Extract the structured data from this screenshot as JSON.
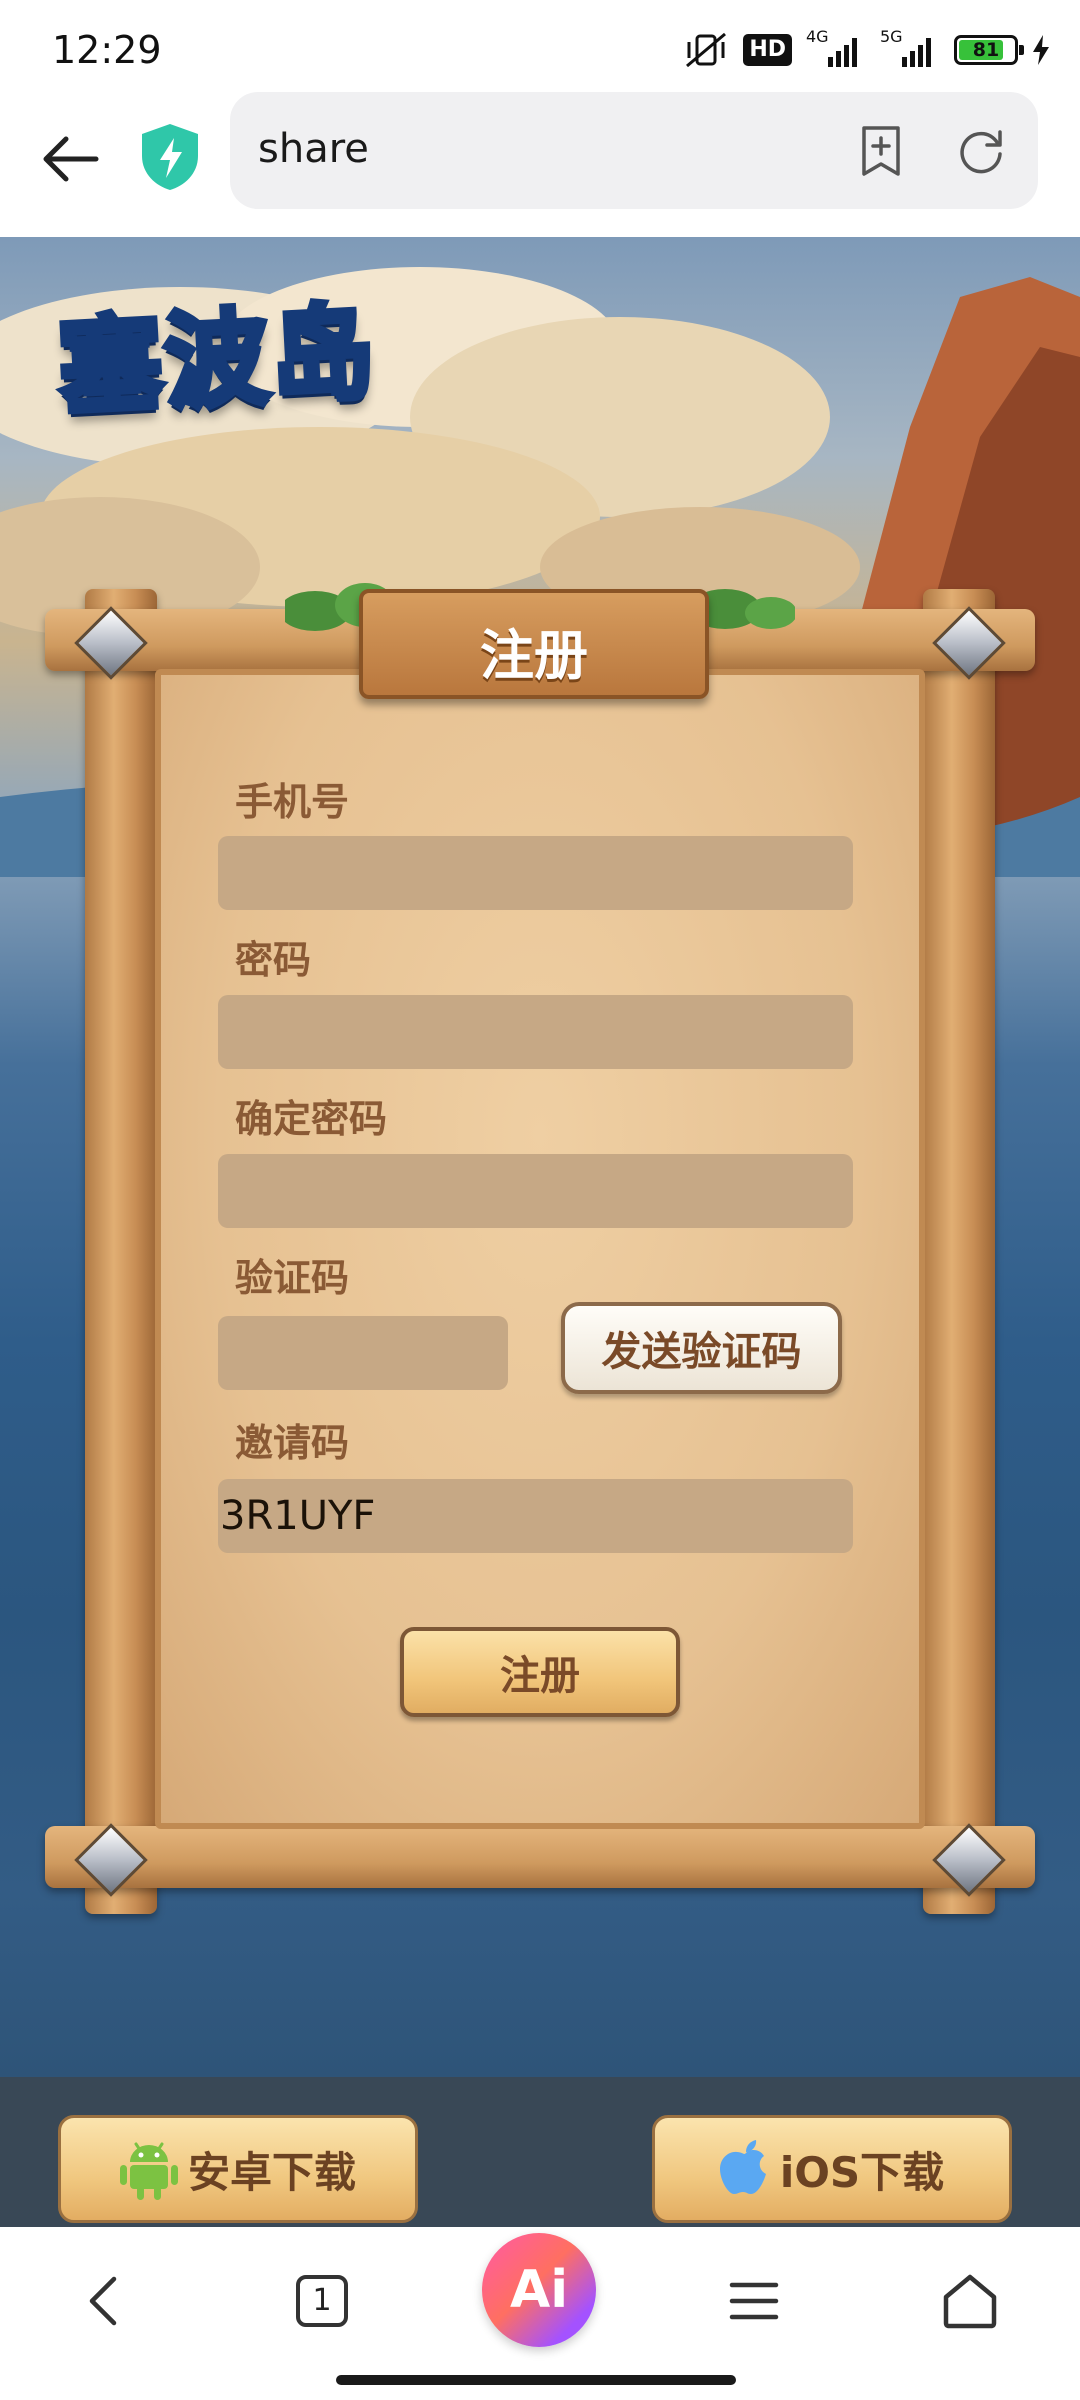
{
  "status_bar": {
    "time": "12:29",
    "hd_badge": "HD",
    "network_1": "4G",
    "network_2": "5G",
    "battery_level": 81,
    "battery_text": "81",
    "battery_color": "#37c13a"
  },
  "browser": {
    "url_text": "share",
    "shield_color": "#2fc7a9"
  },
  "page": {
    "logo_text": "塞波岛",
    "form": {
      "title": "注册",
      "phone_label": "手机号",
      "phone_value": "",
      "password_label": "密码",
      "password_value": "",
      "confirm_label": "确定密码",
      "confirm_value": "",
      "code_label": "验证码",
      "code_value": "",
      "send_code_button": "发送验证码",
      "invite_label": "邀请码",
      "invite_value": "3R1UYF",
      "submit_button": "注册"
    },
    "download": {
      "android_label": "安卓下载",
      "ios_label": "iOS下载",
      "android_icon": "android-robot-icon",
      "ios_icon": "apple-icon"
    }
  },
  "bottom_nav": {
    "tab_count": "1",
    "ai_label": "Ai"
  }
}
